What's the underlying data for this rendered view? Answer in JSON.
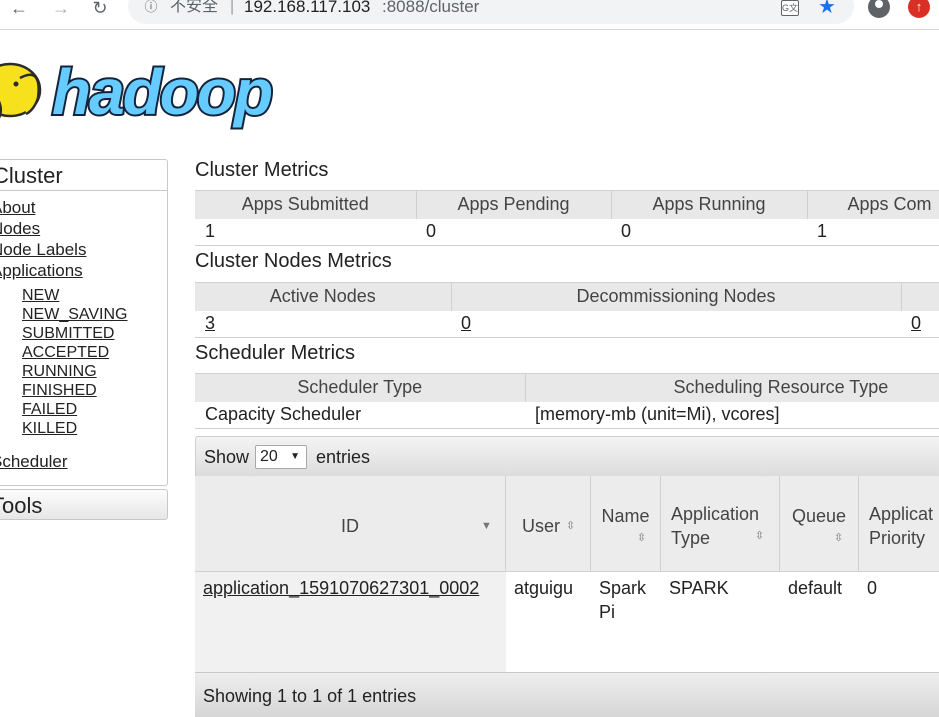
{
  "browser": {
    "back": "←",
    "forward": "→",
    "reload": "↻",
    "info": "ⓘ",
    "security_label": "不安全",
    "separator": "|",
    "host": "192.168.117.103",
    "path": ":8088/cluster",
    "translate_glyph": "G文",
    "star": "★",
    "update": "↑"
  },
  "logo": {
    "text": "hadoop"
  },
  "sidebar": {
    "heading": "Cluster",
    "links": [
      "About",
      "Nodes",
      "Node Labels",
      "Applications"
    ],
    "app_states": [
      "NEW",
      "NEW_SAVING",
      "SUBMITTED",
      "ACCEPTED",
      "RUNNING",
      "FINISHED",
      "FAILED",
      "KILLED"
    ],
    "scheduler": "Scheduler",
    "tools": "Tools"
  },
  "cluster_metrics": {
    "title": "Cluster Metrics",
    "headers": [
      "Apps Submitted",
      "Apps Pending",
      "Apps Running",
      "Apps Com"
    ],
    "values": [
      "1",
      "0",
      "0",
      "1"
    ]
  },
  "nodes_metrics": {
    "title": "Cluster Nodes Metrics",
    "headers": [
      "Active Nodes",
      "Decommissioning Nodes",
      ""
    ],
    "values": [
      "3",
      "0",
      "0"
    ]
  },
  "scheduler_metrics": {
    "title": "Scheduler Metrics",
    "headers": [
      "Scheduler Type",
      "Scheduling Resource Type"
    ],
    "values": [
      "Capacity Scheduler",
      "[memory-mb (unit=Mi), vcores]"
    ]
  },
  "datatable": {
    "show_label": "Show",
    "page_size": "20",
    "select_arrow": "▼",
    "entries_label": "entries",
    "columns": {
      "id": "ID",
      "user": "User",
      "name": "Name",
      "app_type": "Application Type",
      "queue": "Queue",
      "priority": "Applicat Priority"
    },
    "sort_down": "▼",
    "sort_both": "⇳",
    "row": {
      "id": "application_1591070627301_0002",
      "user": "atguigu",
      "name": "Spark Pi",
      "app_type": "SPARK",
      "queue": "default",
      "priority": "0"
    },
    "info": "Showing 1 to 1 of 1 entries"
  }
}
